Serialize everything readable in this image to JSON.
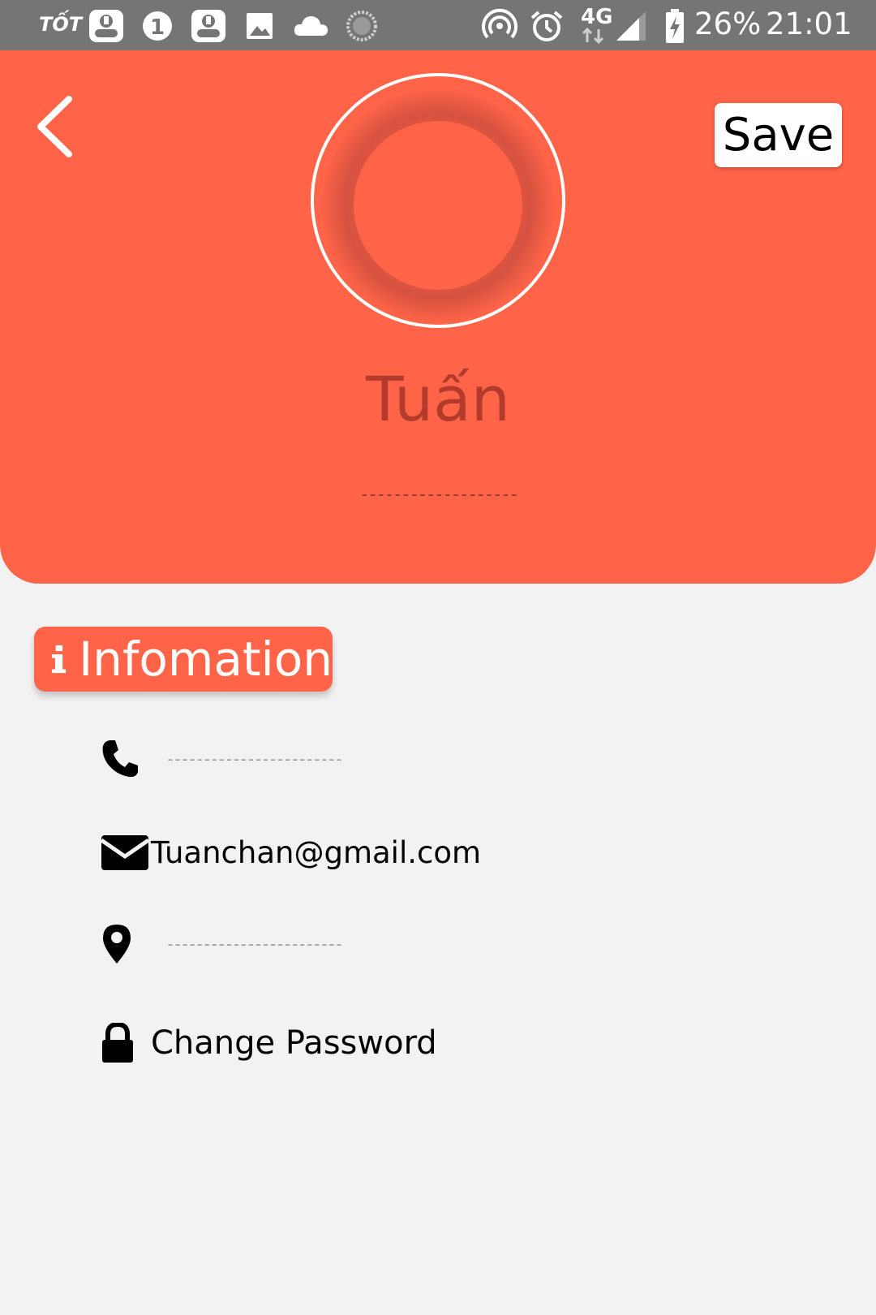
{
  "status_bar": {
    "carrier_logo": "TỐT",
    "network": "4G",
    "battery": "26%",
    "time": "21:01",
    "icons": [
      "piggy-bank-icon",
      "notification-count-icon",
      "piggy-bank-icon",
      "image-icon",
      "cloud-icon",
      "loading-icon",
      "hotspot-icon",
      "alarm-icon",
      "signal-icon",
      "battery-charging-icon"
    ]
  },
  "header": {
    "back_icon": "chevron-left-icon",
    "save_label": "Save",
    "user_name": "Tuấn",
    "subtitle": "-------------------",
    "accent_color": "#ff6448"
  },
  "info": {
    "section_title": "Infomation",
    "section_icon": "info-icon",
    "phone_placeholder": "------------------------",
    "email": "Tuanchan@gmail.com",
    "address_placeholder": "------------------------",
    "change_password_label": "Change Password"
  }
}
